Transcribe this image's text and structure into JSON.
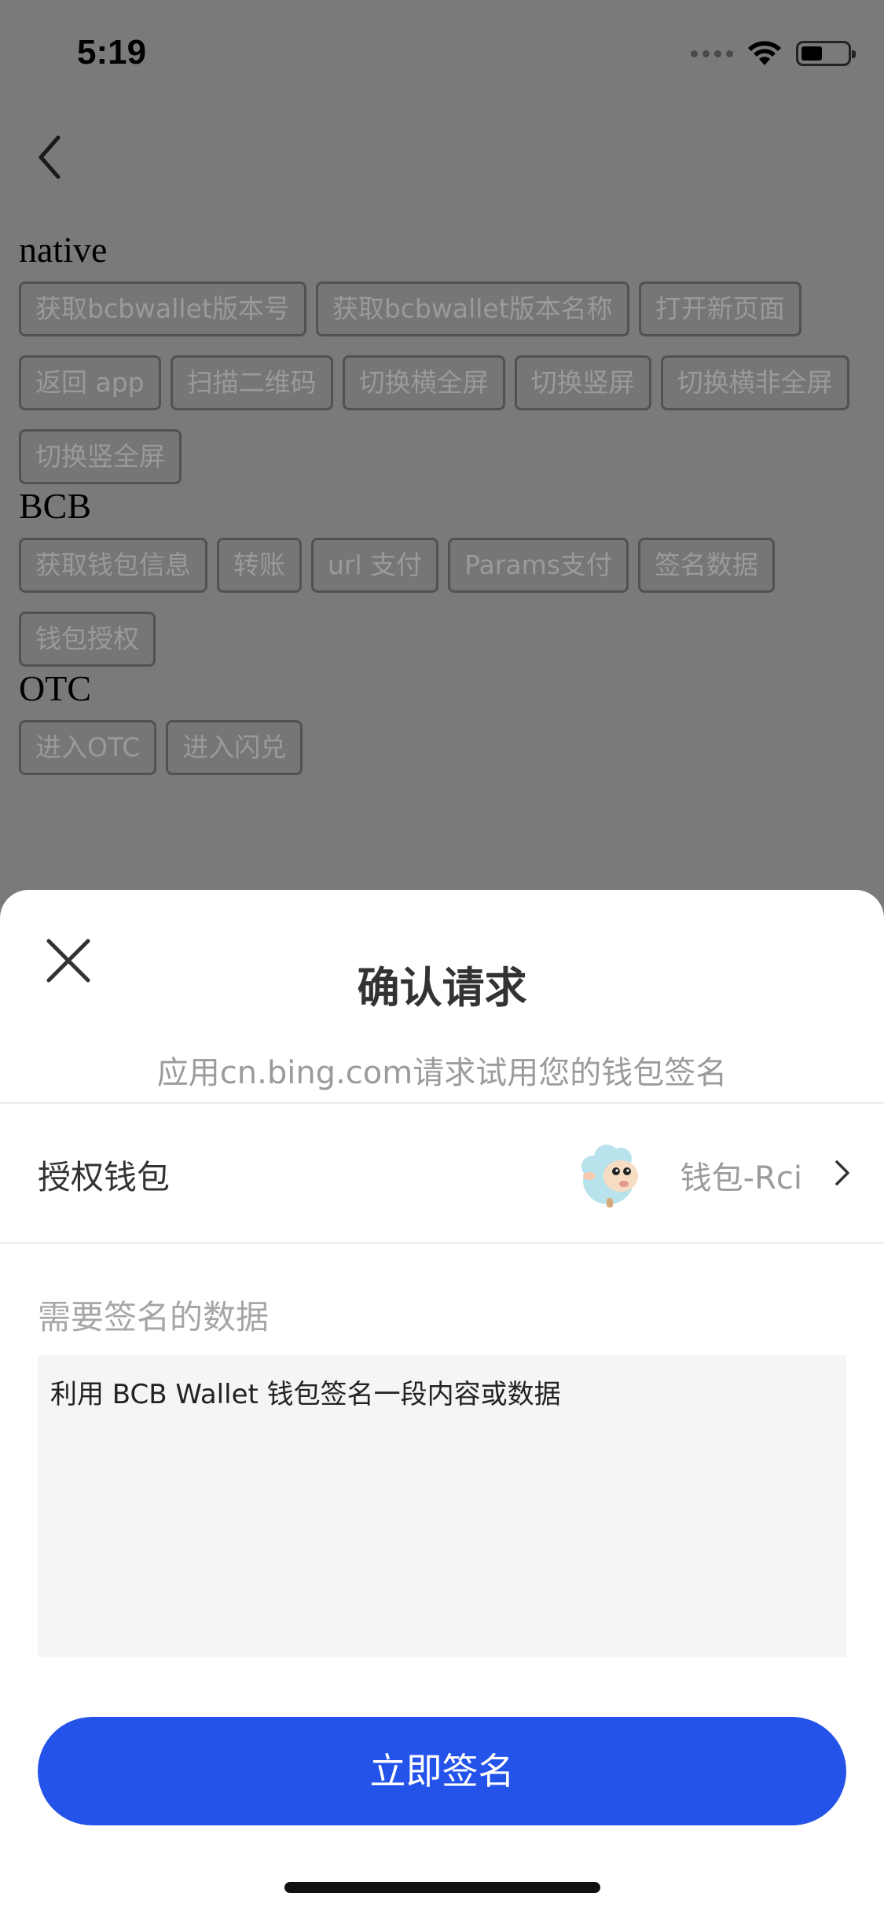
{
  "status_bar": {
    "time": "5:19"
  },
  "demo": {
    "sections": [
      {
        "title": "native",
        "buttons": [
          "获取bcbwallet版本号",
          "获取bcbwallet版本名称",
          "打开新页面",
          "返回 app",
          "扫描二维码",
          "切换横全屏",
          "切换竖屏",
          "切换横非全屏",
          "切换竖全屏"
        ]
      },
      {
        "title": "BCB",
        "buttons": [
          "获取钱包信息",
          "转账",
          "url 支付",
          "Params支付",
          "签名数据",
          "钱包授权"
        ]
      },
      {
        "title": "OTC",
        "buttons": [
          "进入OTC",
          "进入闪兑"
        ]
      }
    ]
  },
  "sheet": {
    "title": "确认请求",
    "subtitle": "应用cn.bing.com请求试用您的钱包签名",
    "wallet_label": "授权钱包",
    "wallet_name": "钱包-Rci",
    "data_label": "需要签名的数据",
    "data_content": "利用 BCB Wallet 钱包签名一段内容或数据",
    "sign_button": "立即签名"
  },
  "colors": {
    "accent": "#2453ea",
    "overlay": "#7a7a7a",
    "data_box_bg": "#f4f5f7"
  }
}
